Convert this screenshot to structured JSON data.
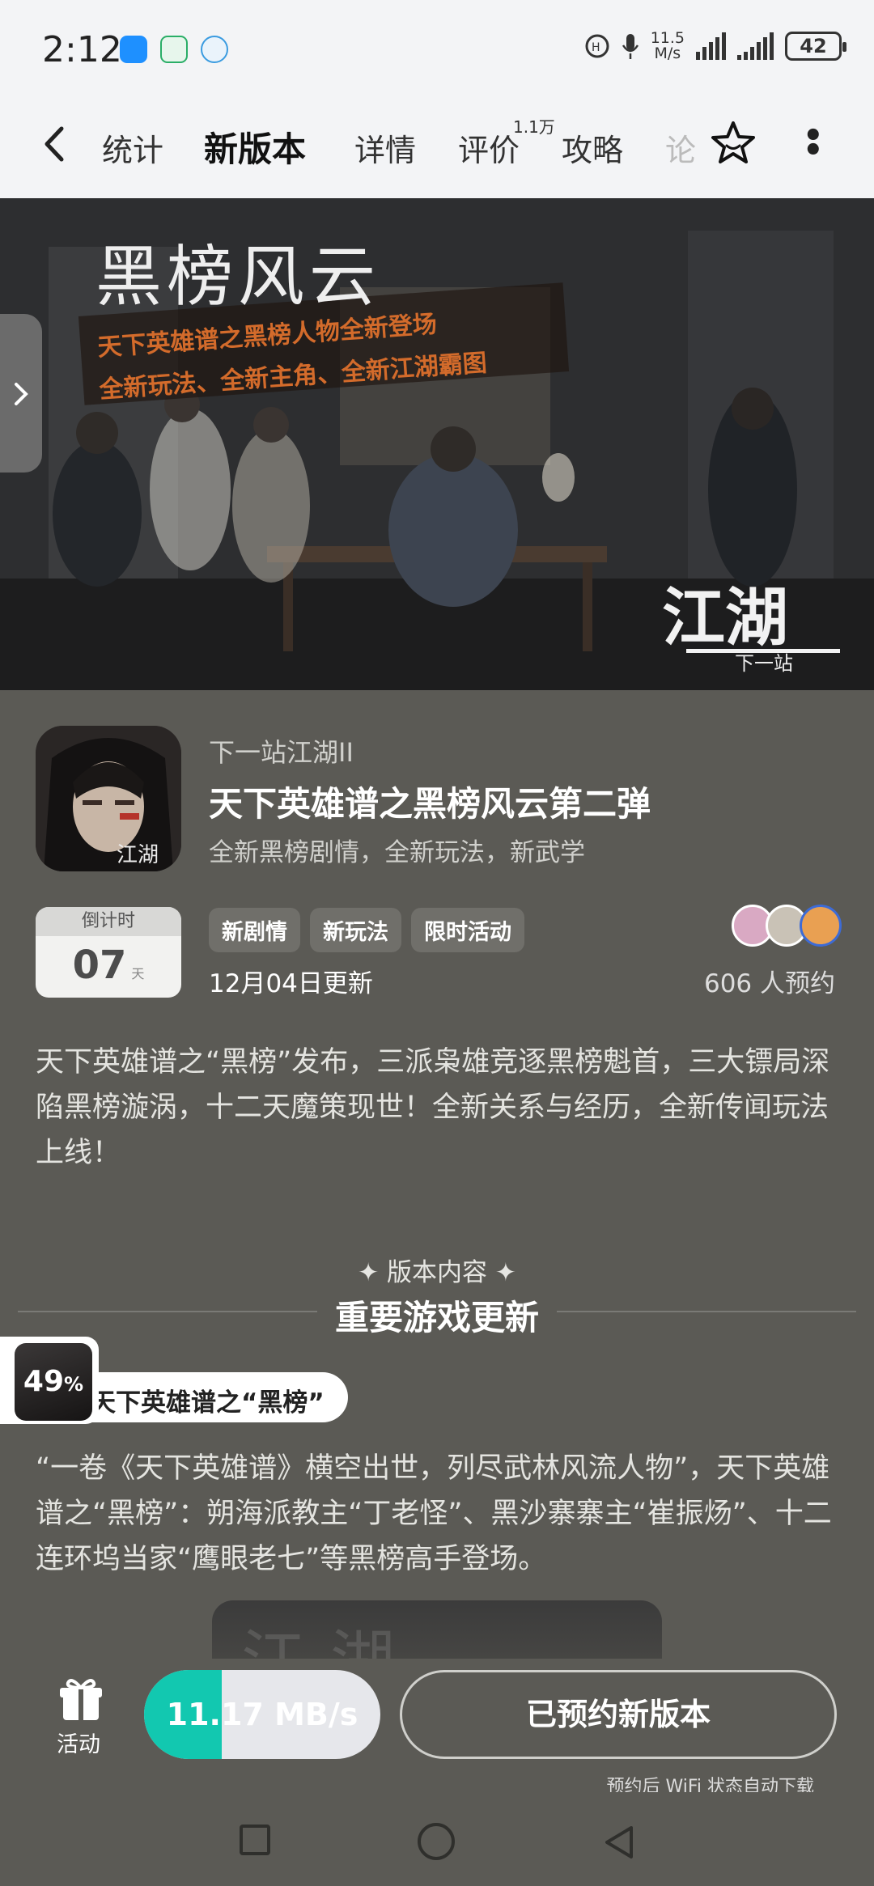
{
  "status_bar": {
    "time": "2:12",
    "net_speed_value": "11.5",
    "net_speed_unit": "M/s",
    "battery": "42",
    "colors": {
      "background": "#f3f4f6"
    }
  },
  "nav": {
    "back_icon": "chevron-left-icon",
    "tabs": [
      {
        "label": "统计"
      },
      {
        "label": "新版本"
      },
      {
        "label": "详情"
      },
      {
        "label": "评价"
      },
      {
        "label": "攻略"
      },
      {
        "label": "论"
      }
    ],
    "review_count": "1.1万",
    "active_tab": "新版本",
    "accent": "#14c9b3"
  },
  "banner": {
    "title": "黑榜风云",
    "subtitle_line1": "天下英雄谱之黑榜人物全新登场",
    "subtitle_line2": "全新玩法、全新主角、全新江湖霸图",
    "logo_text": "江湖",
    "logo_sub": "下一站"
  },
  "app": {
    "developer_game": "下一站江湖II",
    "update_title": "天下英雄谱之黑榜风云第二弹",
    "tagline": "全新黑榜剧情，全新玩法，新武学",
    "icon_logo_text": "江湖"
  },
  "countdown": {
    "header": "倒计时",
    "days": "07",
    "unit": "天"
  },
  "tags": [
    "新剧情",
    "新玩法",
    "限时活动"
  ],
  "update_date": "12月04日更新",
  "reservations": "606 人预约",
  "description": "天下英雄谱之“黑榜”发布，三派枭雄竞逐黑榜魁首，三大镖局深陷黑榜漩涡，十二天魔策现世！全新关系与经历，全新传闻玩法上线！",
  "section": {
    "label": "✦ 版本内容 ✦",
    "title": "重要游戏更新"
  },
  "feature": {
    "pill_title": "天下英雄谱之“黑榜”",
    "body": "“一卷《天下英雄谱》横空出世，列尽武林风流人物”，天下英雄谱之“黑榜”：朔海派教主“丁老怪”、黑沙寨寨主“崔振炀”、十二连环坞当家“鹰眼老七”等黑榜高手登场。",
    "preview_text": "江湖"
  },
  "floating_badge": {
    "percent": "49",
    "percent_sign": "%"
  },
  "bottom_bar": {
    "activity_label": "活动",
    "download_speed": "11.17 MB/s",
    "download_progress": 0.33,
    "reserved_button": "已预约新版本",
    "hint": "预约后 WiFi 状态自动下载",
    "colors": {
      "progress": "#12c8b0",
      "track": "#e6e7eb"
    }
  }
}
